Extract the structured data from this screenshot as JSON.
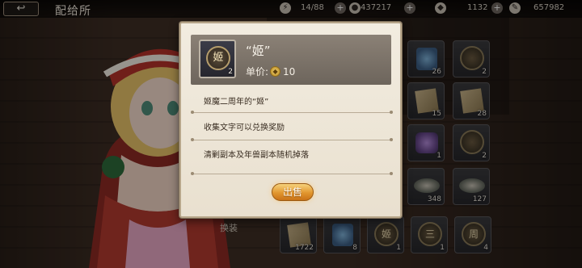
{
  "header": {
    "back_glyph": "↩",
    "title": "配给所",
    "resources": [
      {
        "icon": "stamina-icon",
        "value": "14/88"
      },
      {
        "icon": "gold-coin-icon",
        "value": "437217"
      },
      {
        "icon": "gem-icon",
        "value": "1132"
      },
      {
        "icon": "feather-icon",
        "value": "657982"
      }
    ],
    "plus_glyph": "+"
  },
  "inventory": {
    "counts": [
      "26",
      "2",
      "15",
      "28",
      "1",
      "2",
      "348",
      "127"
    ],
    "bottom_counts": [
      "1722",
      "8",
      "1",
      "1",
      "4"
    ],
    "glyphs": [
      "姬",
      "三",
      "周"
    ]
  },
  "side_label": "换装",
  "popup": {
    "item_name": "“姬”",
    "item_coin_char": "姬",
    "item_quantity": "2",
    "price_label": "单价:",
    "price_coin": "◆",
    "price_value": "10",
    "descriptions": [
      "姬魔二周年的“姬”",
      "收集文字可以兑换奖励",
      "清剿副本及年兽副本随机掉落"
    ],
    "sell_label": "出售"
  }
}
